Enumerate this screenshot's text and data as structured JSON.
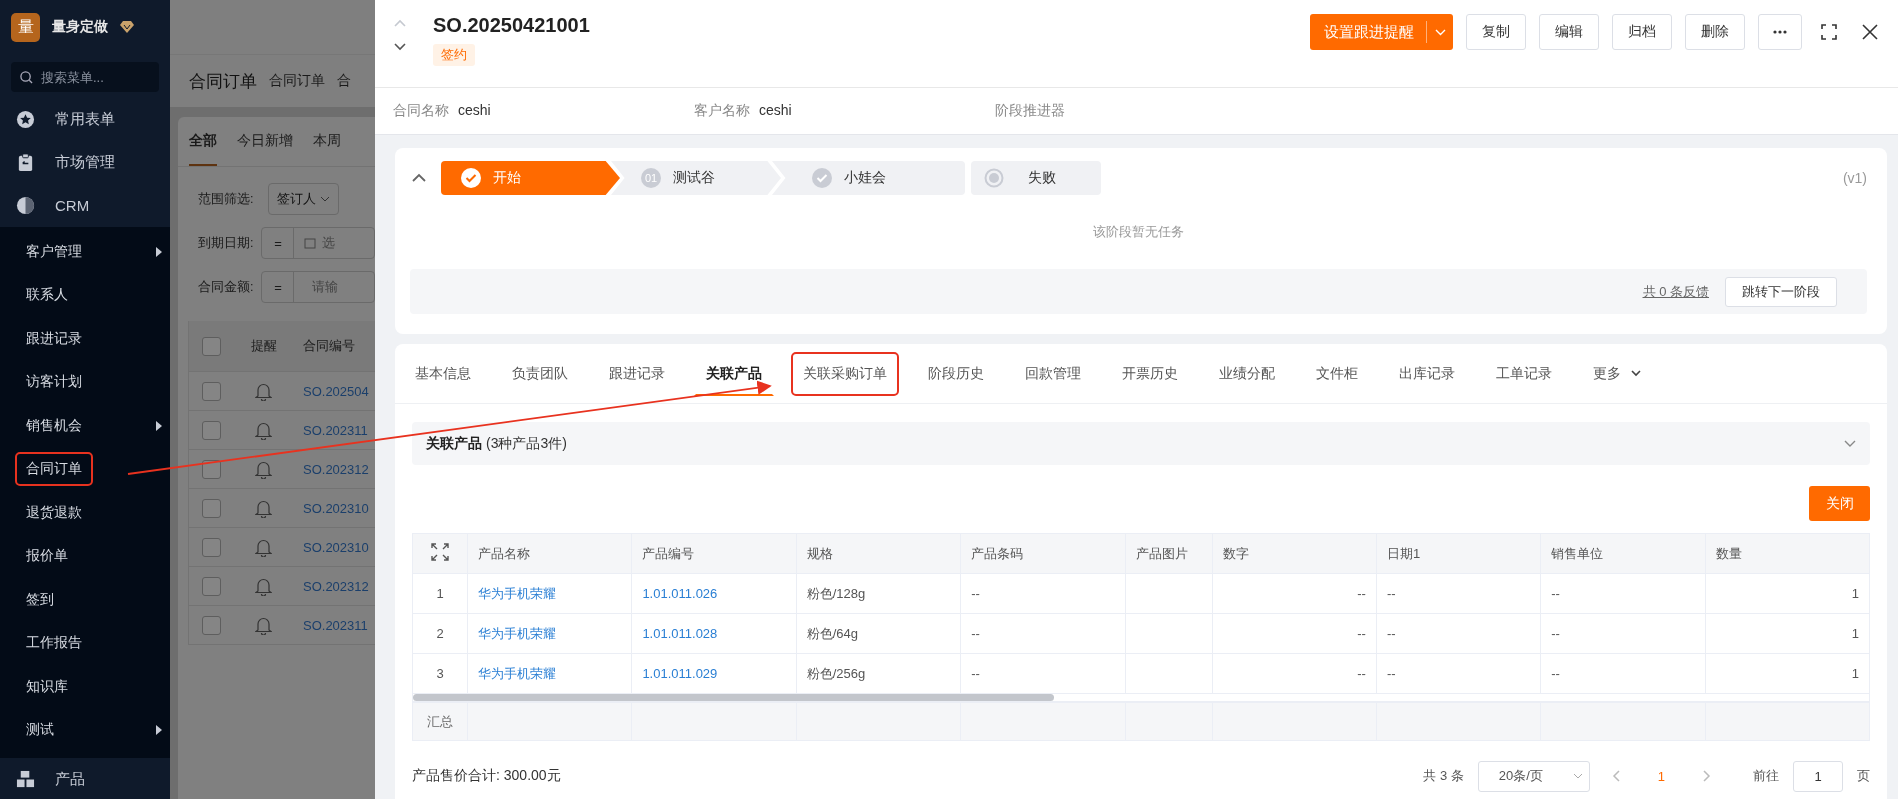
{
  "sidebar": {
    "logo": "量",
    "brand": "量身定做",
    "search": {
      "placeholder": "搜索菜单..."
    },
    "menu": [
      {
        "label": "常用表单"
      },
      {
        "label": "市场管理"
      },
      {
        "label": "CRM",
        "children": [
          {
            "label": "客户管理",
            "has_submenu": true,
            "highlighted": false
          },
          {
            "label": "联系人",
            "has_submenu": false,
            "highlighted": false
          },
          {
            "label": "跟进记录",
            "has_submenu": false,
            "highlighted": false
          },
          {
            "label": "访客计划",
            "has_submenu": false,
            "highlighted": false
          },
          {
            "label": "销售机会",
            "has_submenu": true,
            "highlighted": false
          },
          {
            "label": "合同订单",
            "has_submenu": false,
            "highlighted": true
          },
          {
            "label": "退货退款",
            "has_submenu": false,
            "highlighted": false
          },
          {
            "label": "报价单",
            "has_submenu": false,
            "highlighted": false
          },
          {
            "label": "签到",
            "has_submenu": false,
            "highlighted": false
          },
          {
            "label": "工作报告",
            "has_submenu": false,
            "highlighted": false
          },
          {
            "label": "知识库",
            "has_submenu": false,
            "highlighted": false
          },
          {
            "label": "测试",
            "has_submenu": true,
            "highlighted": false
          }
        ]
      },
      {
        "label": "产品"
      }
    ]
  },
  "background_page": {
    "title": "合同订单",
    "breadcrumbs": [
      "合同订单",
      "合"
    ],
    "tabs": [
      {
        "label": "全部",
        "selected": true
      },
      {
        "label": "今日新增",
        "selected": false
      },
      {
        "label": "本周",
        "selected": false
      }
    ],
    "filters": [
      {
        "label": "范围筛选:",
        "kind": "select",
        "value": "签订人"
      },
      {
        "label": "到期日期:",
        "kind": "date",
        "operator": "=",
        "placeholder": "选"
      },
      {
        "label": "合同金额:",
        "kind": "number",
        "operator": "=",
        "placeholder": "请输"
      }
    ],
    "table": {
      "select_all_checked": false,
      "columns": [
        "提醒",
        "合同编号"
      ],
      "rows": [
        {
          "checked": false,
          "number": "SO.202504"
        },
        {
          "checked": false,
          "number": "SO.202311"
        },
        {
          "checked": false,
          "number": "SO.202312"
        },
        {
          "checked": false,
          "number": "SO.202310"
        },
        {
          "checked": false,
          "number": "SO.202310"
        },
        {
          "checked": false,
          "number": "SO.202312"
        },
        {
          "checked": false,
          "number": "SO.202311"
        }
      ]
    }
  },
  "drawer": {
    "title": "SO.20250421001",
    "status_tag": "签约",
    "primary_action": "设置跟进提醒",
    "buttons": [
      "复制",
      "编辑",
      "归档",
      "删除"
    ],
    "info_fields": [
      {
        "label": "合同名称",
        "value": "ceshi"
      },
      {
        "label": "客户名称",
        "value": "ceshi"
      },
      {
        "label": "阶段推进器"
      }
    ],
    "stage_panel": {
      "stages": [
        {
          "label": "开始",
          "kind": "current"
        },
        {
          "label": "测试谷",
          "kind": "numbered",
          "number": "01"
        },
        {
          "label": "小娃会",
          "kind": "checked"
        },
        {
          "label": "失败",
          "kind": "fail"
        }
      ],
      "version": "(v1)",
      "empty_message": "该阶段暂无任务",
      "feedback_link": "共 0 条反馈",
      "next_button": "跳转下一阶段"
    },
    "tabs": [
      {
        "label": "基本信息",
        "kind": "tab",
        "selected": false,
        "highlighted": false
      },
      {
        "label": "负责团队",
        "kind": "tab",
        "selected": false,
        "highlighted": false
      },
      {
        "label": "跟进记录",
        "kind": "tab",
        "selected": false,
        "highlighted": false
      },
      {
        "label": "关联产品",
        "kind": "tab",
        "selected": true,
        "highlighted": false
      },
      {
        "label": "关联采购订单",
        "kind": "tab",
        "selected": false,
        "highlighted": true
      },
      {
        "label": "阶段历史",
        "kind": "tab",
        "selected": false,
        "highlighted": false
      },
      {
        "label": "回款管理",
        "kind": "tab",
        "selected": false,
        "highlighted": false
      },
      {
        "label": "开票历史",
        "kind": "tab",
        "selected": false,
        "highlighted": false
      },
      {
        "label": "业绩分配",
        "kind": "tab",
        "selected": false,
        "highlighted": false
      },
      {
        "label": "文件柜",
        "kind": "tab",
        "selected": false,
        "highlighted": false
      },
      {
        "label": "出库记录",
        "kind": "tab",
        "selected": false,
        "highlighted": false
      },
      {
        "label": "工单记录",
        "kind": "tab",
        "selected": false,
        "highlighted": false
      },
      {
        "label": "更多",
        "kind": "dropdown",
        "selected": false,
        "highlighted": false
      }
    ],
    "products": {
      "title": "关联产品",
      "summary": "(3种产品3件)",
      "close_button": "关闭",
      "table": {
        "columns": [
          {
            "label": "产品名称",
            "kind": "link"
          },
          {
            "label": "产品编号",
            "kind": "link"
          },
          {
            "label": "规格",
            "kind": "text"
          },
          {
            "label": "产品条码",
            "kind": "text"
          },
          {
            "label": "产品图片",
            "kind": "image"
          },
          {
            "label": "数字",
            "kind": "number"
          },
          {
            "label": "日期1",
            "kind": "text"
          },
          {
            "label": "销售单位",
            "kind": "text"
          },
          {
            "label": "数量",
            "kind": "number"
          }
        ],
        "rows": [
          {
            "index": "1",
            "cells": [
              "华为手机荣耀",
              "1.01.011.026",
              "粉色/128g",
              "--",
              "",
              "--",
              "--",
              "--",
              "1"
            ]
          },
          {
            "index": "2",
            "cells": [
              "华为手机荣耀",
              "1.01.011.028",
              "粉色/64g",
              "--",
              "",
              "--",
              "--",
              "--",
              "1"
            ]
          },
          {
            "index": "3",
            "cells": [
              "华为手机荣耀",
              "1.01.011.029",
              "粉色/256g",
              "--",
              "",
              "--",
              "--",
              "--",
              "1"
            ]
          }
        ],
        "summary_label": "汇总"
      },
      "total": "产品售价合计: 300.00元",
      "pagination": {
        "total": "共 3 条",
        "page_size": "20条/页",
        "current_page": "1",
        "goto_label": "前往",
        "goto_value": "1",
        "page_suffix": "页"
      }
    }
  }
}
